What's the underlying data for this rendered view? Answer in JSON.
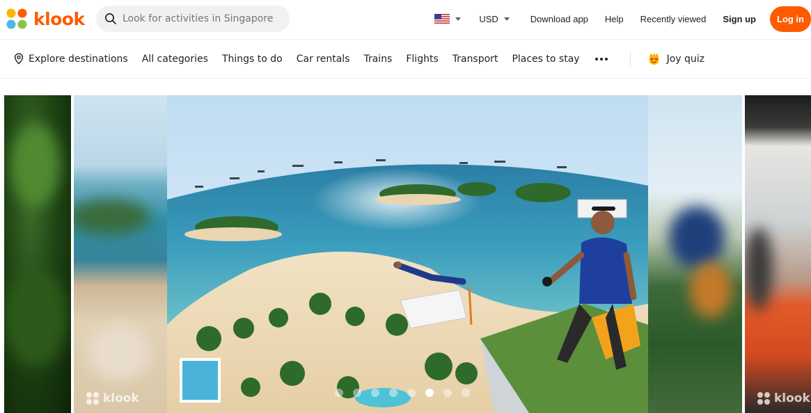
{
  "brand": {
    "name": "klook",
    "color": "#ff5b00"
  },
  "search": {
    "placeholder": "Look for activities in Singapore",
    "value": ""
  },
  "header": {
    "country_flag": "us-flag-icon",
    "currency": "USD",
    "links": [
      "Download app",
      "Help",
      "Recently viewed"
    ],
    "signup_label": "Sign up",
    "login_label": "Log in"
  },
  "nav": {
    "explore": "Explore destinations",
    "items": [
      "All categories",
      "Things to do",
      "Car rentals",
      "Trains",
      "Flights",
      "Transport",
      "Places to stay"
    ],
    "more_icon": "more-dots-icon",
    "joy_quiz": "Joy quiz"
  },
  "carousel": {
    "watermark": "klook",
    "slide_count": 8,
    "active_index": 5
  }
}
